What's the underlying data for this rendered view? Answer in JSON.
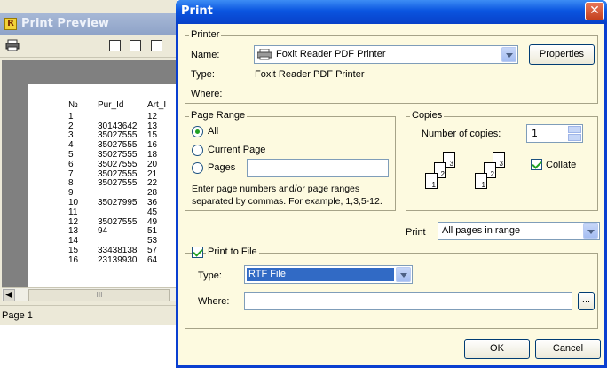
{
  "preview": {
    "title": "Print Preview",
    "logo_letter": "R",
    "status": "Page 1",
    "scroll_thumb": "III",
    "table": {
      "headers": [
        "№",
        "Pur_Id",
        "Art_I"
      ],
      "rows": [
        [
          "1",
          "",
          "12"
        ],
        [
          "2",
          "30143642",
          "13"
        ],
        [
          "3",
          "35027555",
          "15"
        ],
        [
          "4",
          "35027555",
          "16"
        ],
        [
          "5",
          "35027555",
          "18"
        ],
        [
          "6",
          "35027555",
          "20"
        ],
        [
          "7",
          "35027555",
          "21"
        ],
        [
          "8",
          "35027555",
          "22"
        ],
        [
          "9",
          "",
          "28"
        ],
        [
          "10",
          "35027995",
          "36"
        ],
        [
          "11",
          "",
          "45"
        ],
        [
          "12",
          "35027555",
          "49"
        ],
        [
          "13",
          "94",
          "51"
        ],
        [
          "14",
          "",
          "53"
        ],
        [
          "15",
          "33438138",
          "57"
        ],
        [
          "16",
          "23139930",
          "64"
        ]
      ]
    }
  },
  "dialog": {
    "title": "Print",
    "printer": {
      "group": "Printer",
      "name_label": "Name:",
      "name_value": "Foxit Reader PDF Printer",
      "properties": "Properties",
      "type_label": "Type:",
      "type_value": "Foxit Reader PDF Printer",
      "where_label": "Where:"
    },
    "page_range": {
      "group": "Page Range",
      "all": "All",
      "current": "Current Page",
      "pages": "Pages",
      "hint1": "Enter page numbers and/or page ranges",
      "hint2": "separated by commas.  For example, 1,3,5-12."
    },
    "copies": {
      "group": "Copies",
      "number_label": "Number of copies:",
      "number_value": "1",
      "collate": "Collate"
    },
    "print_what": {
      "label": "Print",
      "value": "All pages in range"
    },
    "print_to_file": {
      "label": "Print to File",
      "type_label": "Type:",
      "type_value": "RTF File",
      "where_label": "Where:",
      "browse": "..."
    },
    "ok": "OK",
    "cancel": "Cancel",
    "close_glyph": "✕"
  }
}
